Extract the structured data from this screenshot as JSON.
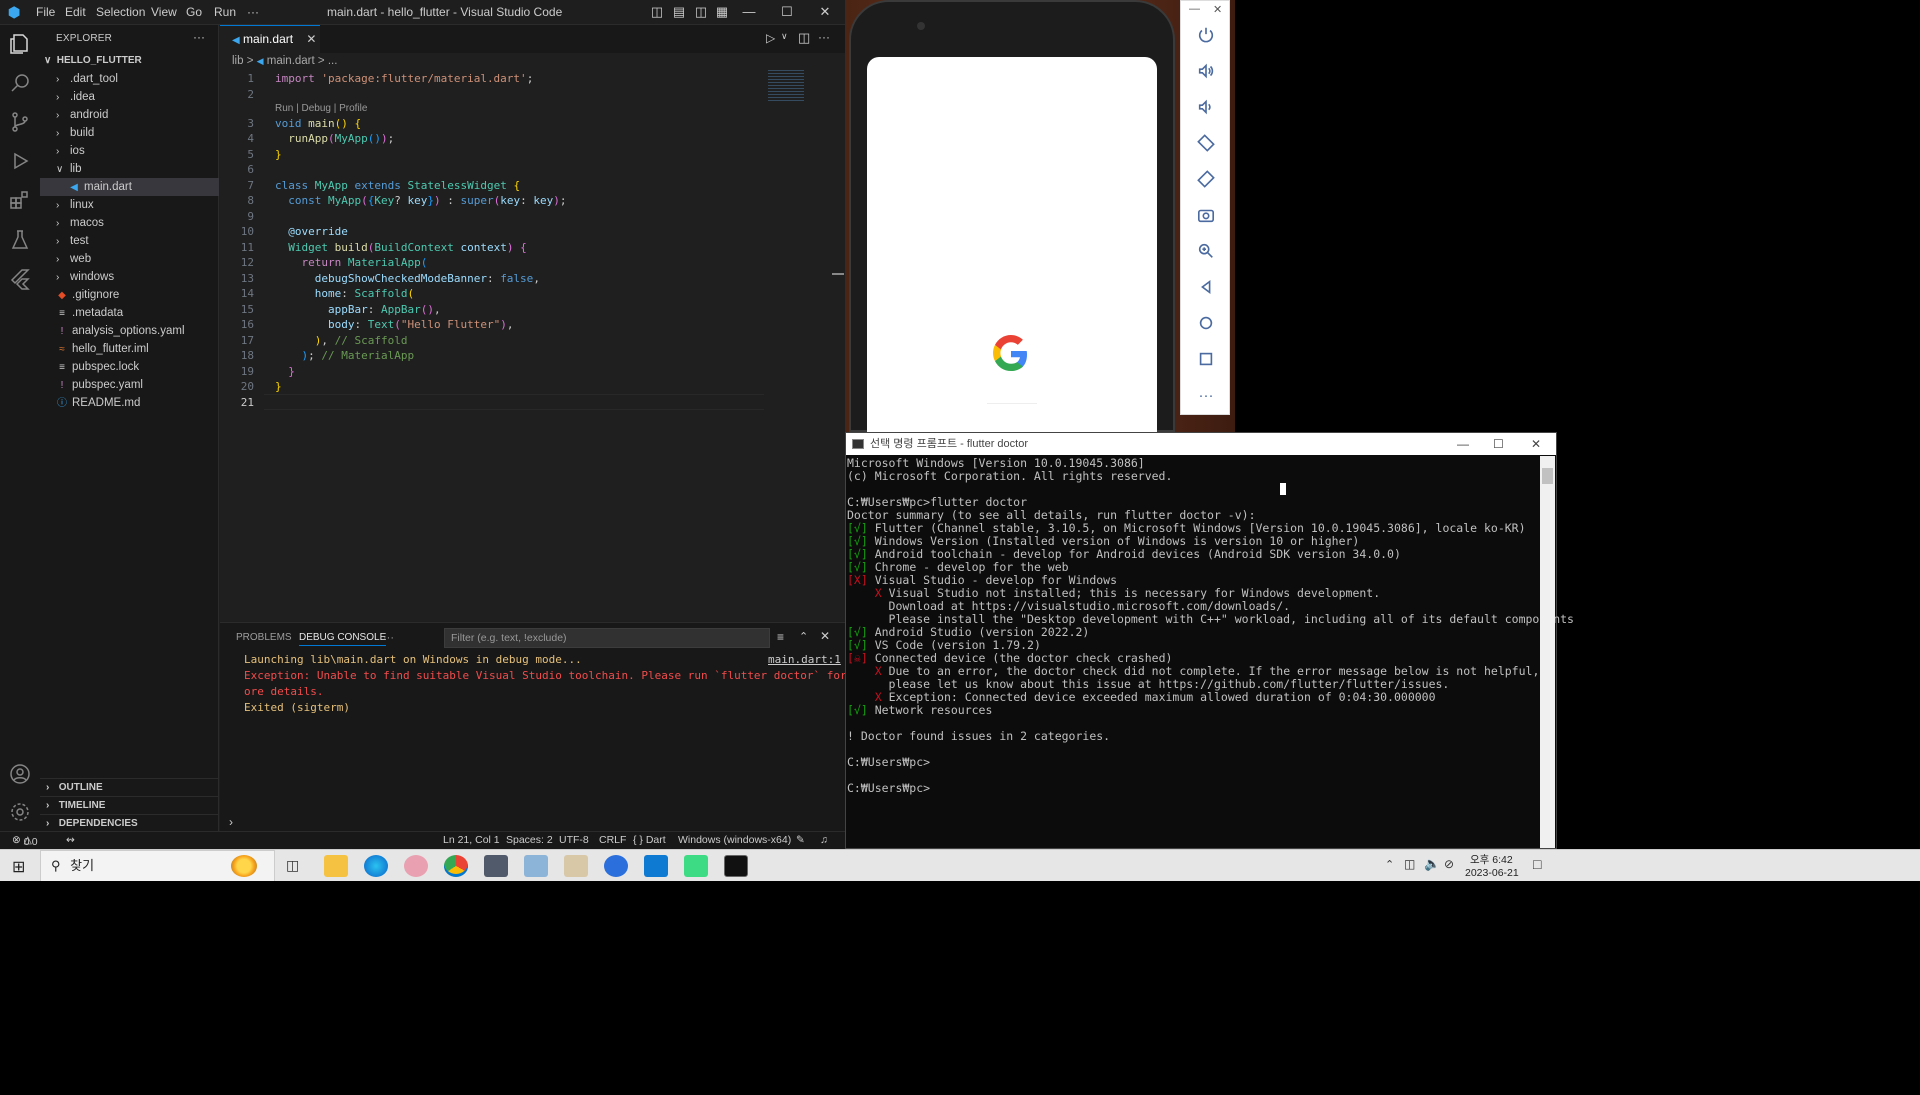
{
  "window": {
    "title": "main.dart - hello_flutter - Visual Studio Code",
    "menus": [
      "File",
      "Edit",
      "Selection",
      "View",
      "Go",
      "Run",
      "···"
    ]
  },
  "explorer": {
    "header": "EXPLORER",
    "more": "···",
    "root": "HELLO_FLUTTER",
    "items": [
      {
        "label": ".dart_tool",
        "type": "folder"
      },
      {
        "label": ".idea",
        "type": "folder"
      },
      {
        "label": "android",
        "type": "folder"
      },
      {
        "label": "build",
        "type": "folder"
      },
      {
        "label": "ios",
        "type": "folder"
      },
      {
        "label": "lib",
        "type": "folder-open"
      },
      {
        "label": "main.dart",
        "type": "dart"
      },
      {
        "label": "linux",
        "type": "folder"
      },
      {
        "label": "macos",
        "type": "folder"
      },
      {
        "label": "test",
        "type": "folder"
      },
      {
        "label": "web",
        "type": "folder"
      },
      {
        "label": "windows",
        "type": "folder"
      },
      {
        "label": ".gitignore",
        "type": "git"
      },
      {
        "label": ".metadata",
        "type": "meta"
      },
      {
        "label": "analysis_options.yaml",
        "type": "yaml"
      },
      {
        "label": "hello_flutter.iml",
        "type": "xml"
      },
      {
        "label": "pubspec.lock",
        "type": "lock"
      },
      {
        "label": "pubspec.yaml",
        "type": "yaml"
      },
      {
        "label": "README.md",
        "type": "info"
      }
    ],
    "sections": [
      "OUTLINE",
      "TIMELINE",
      "DEPENDENCIES"
    ]
  },
  "editor": {
    "tab": "main.dart",
    "breadcrumb": [
      "lib",
      ">",
      "main.dart",
      ">",
      "..."
    ],
    "codelens": "Run | Debug | Profile",
    "line_numbers": [
      "1",
      "2",
      "3",
      "4",
      "5",
      "6",
      "7",
      "8",
      "9",
      "10",
      "11",
      "12",
      "13",
      "14",
      "15",
      "16",
      "17",
      "18",
      "19",
      "20",
      "21"
    ]
  },
  "panel": {
    "tabs": [
      "PROBLEMS",
      "DEBUG CONSOLE",
      "···"
    ],
    "filter_placeholder": "Filter (e.g. text, !exclude)",
    "lines": [
      "Launching lib\\main.dart on Windows in debug mode...",
      "Exception: Unable to find suitable Visual Studio toolchain. Please run `flutter doctor` for m",
      "ore details.",
      "Exited (sigterm)"
    ],
    "source_link": "main.dart:1"
  },
  "statusbar": {
    "errors": "0",
    "warnings": "0",
    "position": "Ln 21, Col 1",
    "spaces": "Spaces: 2",
    "encoding": "UTF-8",
    "eol": "CRLF",
    "language": "{ } Dart",
    "device": "Windows (windows-x64)"
  },
  "cmd": {
    "title": "선택 명령 프롬프트 - flutter  doctor",
    "lines": [
      "Microsoft Windows [Version 10.0.19045.3086]",
      "(c) Microsoft Corporation. All rights reserved.",
      "",
      "C:₩Users₩pc>flutter doctor",
      "Doctor summary (to see all details, run flutter doctor -v):",
      "[√] Flutter (Channel stable, 3.10.5, on Microsoft Windows [Version 10.0.19045.3086], locale ko-KR)",
      "[√] Windows Version (Installed version of Windows is version 10 or higher)",
      "[√] Android toolchain - develop for Android devices (Android SDK version 34.0.0)",
      "[√] Chrome - develop for the web",
      "[X] Visual Studio - develop for Windows",
      "    X Visual Studio not installed; this is necessary for Windows development.",
      "      Download at https://visualstudio.microsoft.com/downloads/.",
      "      Please install the \"Desktop development with C++\" workload, including all of its default components",
      "[√] Android Studio (version 2022.2)",
      "[√] VS Code (version 1.79.2)",
      "[☠] Connected device (the doctor check crashed)",
      "    X Due to an error, the doctor check did not complete. If the error message below is not helpful,",
      "      please let us know about this issue at https://github.com/flutter/flutter/issues.",
      "    X Exception: Connected device exceeded maximum allowed duration of 0:04:30.000000",
      "[√] Network resources",
      "",
      "! Doctor found issues in 2 categories.",
      "",
      "C:₩Users₩pc>",
      "",
      "C:₩Users₩pc>"
    ]
  },
  "emulator": {
    "controls": [
      "power-icon",
      "volume-up-icon",
      "volume-down-icon",
      "rotate-left-icon",
      "rotate-right-icon",
      "camera-icon",
      "zoom-icon",
      "back-icon",
      "home-icon",
      "overview-icon",
      "more-icon"
    ]
  },
  "taskbar": {
    "search_text": "찾기",
    "clock_time": "오후 6:42",
    "clock_date": "2023-06-21"
  }
}
